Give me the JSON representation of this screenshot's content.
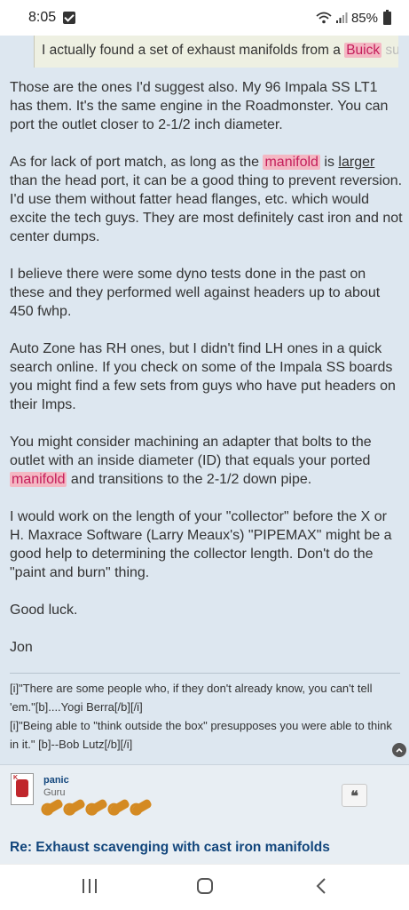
{
  "status_bar": {
    "time": "8:05",
    "battery": "85%"
  },
  "quote": {
    "pre": "I actually found a set of exhaust manifolds from a ",
    "highlight": "Buick",
    "ghost": " sub-roadmaster"
  },
  "post": {
    "p1": "Those are the ones I'd suggest also. My 96 Impala SS LT1 has them. It's the same engine in the Roadmonster. You can port the outlet closer to 2-1/2 inch diameter.",
    "p2_a": "As for lack of port match, as long as the ",
    "p2_hl": "manifold",
    "p2_b": " is ",
    "p2_ul": "larger",
    "p2_c": " than the head port, it can be a good thing to prevent reversion. I'd use them without fatter head flanges, etc. which would excite the tech guys. They are most definitely cast iron and not center dumps.",
    "p3": "I believe there were some dyno tests done in the past on these and they performed well against headers up to about 450 fwhp.",
    "p4": "Auto Zone has RH ones, but I didn't find LH ones in a quick search online. If you check on some of the Impala SS boards you might find a few sets from guys who have put headers on their Imps.",
    "p5_a": "You might consider machining an adapter that bolts to the outlet with an inside diameter (ID) that equals your ported ",
    "p5_hl": "manifold",
    "p5_b": " and transitions to the 2-1/2 down pipe.",
    "p6": "I would work on the length of your \"collector\" before the X or H. Maxrace Software (Larry Meaux's) \"PIPEMAX\" might be a good help to determining the collector length. Don't do the \"paint and burn\" thing.",
    "p7": "Good luck.",
    "p8": "Jon"
  },
  "signature": {
    "line1": "[i]\"There are some people who, if they don't already know, you can't tell 'em.\"[b]....Yogi Berra[/b][/i]",
    "line2": "[i]\"Being able to \"think outside the box\" presupposes you were able to think in it.\" [b]--Bob Lutz[/b][/i]"
  },
  "next_post": {
    "username": "panic",
    "rank": "Guru",
    "rank_icon": "wrench-icon",
    "rank_count": 5,
    "quote_button": "❝",
    "title": "Re: Exhaust scavenging with cast iron manifolds"
  },
  "colors": {
    "highlight_bg": "#f4b7c3",
    "highlight_text": "#c41d5a",
    "link": "#12467c",
    "page_bg": "#dde7f0"
  }
}
